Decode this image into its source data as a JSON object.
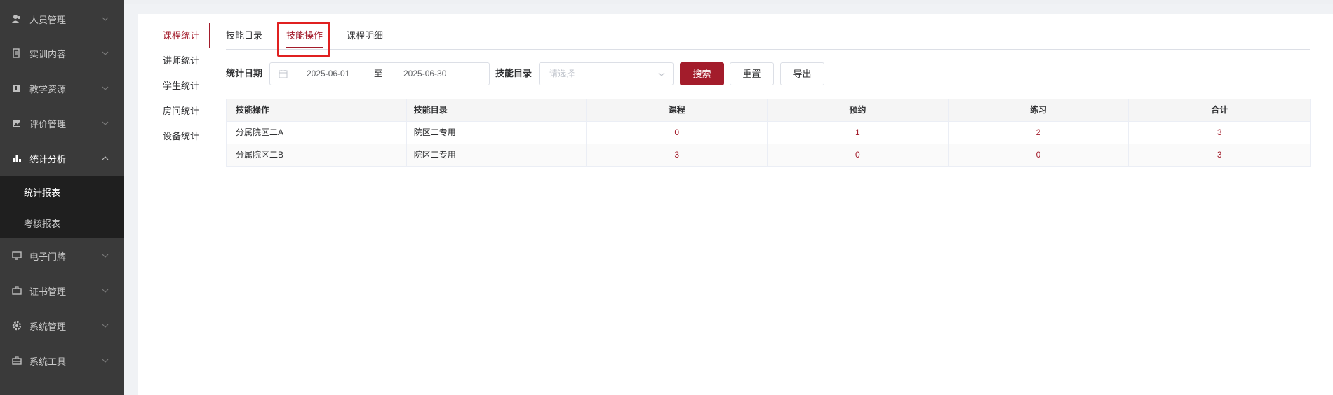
{
  "sidebar": {
    "items": [
      {
        "label": "人员管理",
        "icon": "users-icon"
      },
      {
        "label": "实训内容",
        "icon": "document-icon"
      },
      {
        "label": "教学资源",
        "icon": "book-icon"
      },
      {
        "label": "评价管理",
        "icon": "image-icon"
      },
      {
        "label": "统计分析",
        "icon": "bar-chart-icon"
      },
      {
        "label": "电子门牌",
        "icon": "monitor-icon"
      },
      {
        "label": "证书管理",
        "icon": "briefcase-icon"
      },
      {
        "label": "系统管理",
        "icon": "gear-icon"
      },
      {
        "label": "系统工具",
        "icon": "toolbox-icon"
      }
    ],
    "submenu": [
      "统计报表",
      "考核报表"
    ]
  },
  "vtabs": [
    "课程统计",
    "讲师统计",
    "学生统计",
    "房间统计",
    "设备统计"
  ],
  "htabs": [
    "技能目录",
    "技能操作",
    "课程明细"
  ],
  "filter": {
    "date_label": "统计日期",
    "start_date": "2025-06-01",
    "separator": "至",
    "end_date": "2025-06-30",
    "catalog_label": "技能目录",
    "catalog_placeholder": "请选择",
    "search_label": "搜索",
    "reset_label": "重置",
    "export_label": "导出"
  },
  "table": {
    "headers": [
      "技能操作",
      "技能目录",
      "课程",
      "预约",
      "练习",
      "合计"
    ],
    "rows": [
      [
        "分属院区二A",
        "院区二专用",
        "0",
        "1",
        "2",
        "3"
      ],
      [
        "分属院区二B",
        "院区二专用",
        "3",
        "0",
        "0",
        "3"
      ]
    ]
  },
  "colors": {
    "accent": "#a31c2b",
    "sidebar_bg": "#3a3a3a",
    "submenu_bg": "#1f1f1f",
    "highlight": "#e02020"
  }
}
